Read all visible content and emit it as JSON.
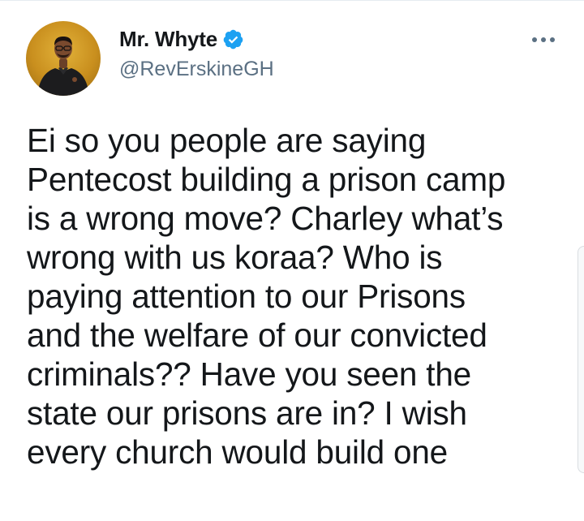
{
  "tweet": {
    "author": {
      "display_name": "Mr. Whyte",
      "handle": "@RevErskineGH",
      "verified": true,
      "avatar_icon": "profile-photo"
    },
    "more_icon": "ellipsis-icon",
    "text_lines": [
      "Ei so you people are saying",
      "Pentecost building a prison camp",
      "is a wrong move? Charley what’s",
      "wrong with us koraa? Who is",
      "paying attention to our Prisons",
      "and the welfare of our convicted",
      "criminals?? Have you seen the",
      "state our prisons are in? I wish",
      "every church would build one"
    ]
  },
  "colors": {
    "text_primary": "#14171a",
    "text_secondary": "#5b7083",
    "verified_blue": "#1da1f2",
    "avatar_background": "#d9a02c"
  }
}
